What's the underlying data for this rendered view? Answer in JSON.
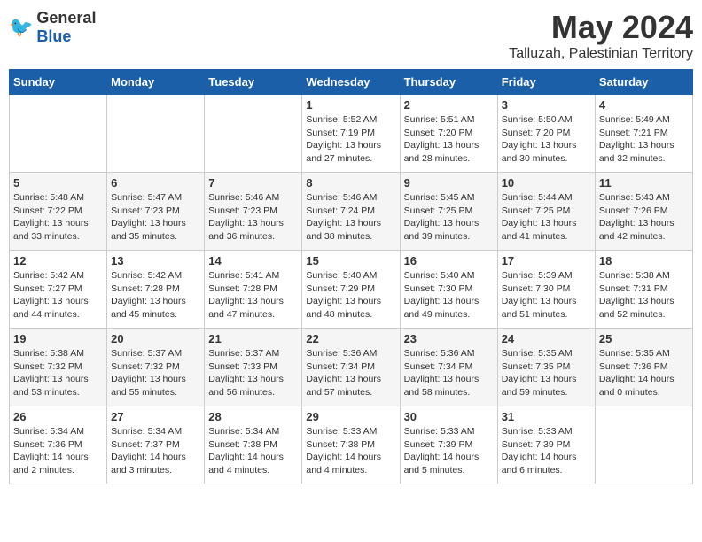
{
  "header": {
    "logo_general": "General",
    "logo_blue": "Blue",
    "month_title": "May 2024",
    "location": "Talluzah, Palestinian Territory"
  },
  "days_of_week": [
    "Sunday",
    "Monday",
    "Tuesday",
    "Wednesday",
    "Thursday",
    "Friday",
    "Saturday"
  ],
  "weeks": [
    {
      "days": [
        {
          "date": "",
          "info": ""
        },
        {
          "date": "",
          "info": ""
        },
        {
          "date": "",
          "info": ""
        },
        {
          "date": "1",
          "info": "Sunrise: 5:52 AM\nSunset: 7:19 PM\nDaylight: 13 hours\nand 27 minutes."
        },
        {
          "date": "2",
          "info": "Sunrise: 5:51 AM\nSunset: 7:20 PM\nDaylight: 13 hours\nand 28 minutes."
        },
        {
          "date": "3",
          "info": "Sunrise: 5:50 AM\nSunset: 7:20 PM\nDaylight: 13 hours\nand 30 minutes."
        },
        {
          "date": "4",
          "info": "Sunrise: 5:49 AM\nSunset: 7:21 PM\nDaylight: 13 hours\nand 32 minutes."
        }
      ]
    },
    {
      "days": [
        {
          "date": "5",
          "info": "Sunrise: 5:48 AM\nSunset: 7:22 PM\nDaylight: 13 hours\nand 33 minutes."
        },
        {
          "date": "6",
          "info": "Sunrise: 5:47 AM\nSunset: 7:23 PM\nDaylight: 13 hours\nand 35 minutes."
        },
        {
          "date": "7",
          "info": "Sunrise: 5:46 AM\nSunset: 7:23 PM\nDaylight: 13 hours\nand 36 minutes."
        },
        {
          "date": "8",
          "info": "Sunrise: 5:46 AM\nSunset: 7:24 PM\nDaylight: 13 hours\nand 38 minutes."
        },
        {
          "date": "9",
          "info": "Sunrise: 5:45 AM\nSunset: 7:25 PM\nDaylight: 13 hours\nand 39 minutes."
        },
        {
          "date": "10",
          "info": "Sunrise: 5:44 AM\nSunset: 7:25 PM\nDaylight: 13 hours\nand 41 minutes."
        },
        {
          "date": "11",
          "info": "Sunrise: 5:43 AM\nSunset: 7:26 PM\nDaylight: 13 hours\nand 42 minutes."
        }
      ]
    },
    {
      "days": [
        {
          "date": "12",
          "info": "Sunrise: 5:42 AM\nSunset: 7:27 PM\nDaylight: 13 hours\nand 44 minutes."
        },
        {
          "date": "13",
          "info": "Sunrise: 5:42 AM\nSunset: 7:28 PM\nDaylight: 13 hours\nand 45 minutes."
        },
        {
          "date": "14",
          "info": "Sunrise: 5:41 AM\nSunset: 7:28 PM\nDaylight: 13 hours\nand 47 minutes."
        },
        {
          "date": "15",
          "info": "Sunrise: 5:40 AM\nSunset: 7:29 PM\nDaylight: 13 hours\nand 48 minutes."
        },
        {
          "date": "16",
          "info": "Sunrise: 5:40 AM\nSunset: 7:30 PM\nDaylight: 13 hours\nand 49 minutes."
        },
        {
          "date": "17",
          "info": "Sunrise: 5:39 AM\nSunset: 7:30 PM\nDaylight: 13 hours\nand 51 minutes."
        },
        {
          "date": "18",
          "info": "Sunrise: 5:38 AM\nSunset: 7:31 PM\nDaylight: 13 hours\nand 52 minutes."
        }
      ]
    },
    {
      "days": [
        {
          "date": "19",
          "info": "Sunrise: 5:38 AM\nSunset: 7:32 PM\nDaylight: 13 hours\nand 53 minutes."
        },
        {
          "date": "20",
          "info": "Sunrise: 5:37 AM\nSunset: 7:32 PM\nDaylight: 13 hours\nand 55 minutes."
        },
        {
          "date": "21",
          "info": "Sunrise: 5:37 AM\nSunset: 7:33 PM\nDaylight: 13 hours\nand 56 minutes."
        },
        {
          "date": "22",
          "info": "Sunrise: 5:36 AM\nSunset: 7:34 PM\nDaylight: 13 hours\nand 57 minutes."
        },
        {
          "date": "23",
          "info": "Sunrise: 5:36 AM\nSunset: 7:34 PM\nDaylight: 13 hours\nand 58 minutes."
        },
        {
          "date": "24",
          "info": "Sunrise: 5:35 AM\nSunset: 7:35 PM\nDaylight: 13 hours\nand 59 minutes."
        },
        {
          "date": "25",
          "info": "Sunrise: 5:35 AM\nSunset: 7:36 PM\nDaylight: 14 hours\nand 0 minutes."
        }
      ]
    },
    {
      "days": [
        {
          "date": "26",
          "info": "Sunrise: 5:34 AM\nSunset: 7:36 PM\nDaylight: 14 hours\nand 2 minutes."
        },
        {
          "date": "27",
          "info": "Sunrise: 5:34 AM\nSunset: 7:37 PM\nDaylight: 14 hours\nand 3 minutes."
        },
        {
          "date": "28",
          "info": "Sunrise: 5:34 AM\nSunset: 7:38 PM\nDaylight: 14 hours\nand 4 minutes."
        },
        {
          "date": "29",
          "info": "Sunrise: 5:33 AM\nSunset: 7:38 PM\nDaylight: 14 hours\nand 4 minutes."
        },
        {
          "date": "30",
          "info": "Sunrise: 5:33 AM\nSunset: 7:39 PM\nDaylight: 14 hours\nand 5 minutes."
        },
        {
          "date": "31",
          "info": "Sunrise: 5:33 AM\nSunset: 7:39 PM\nDaylight: 14 hours\nand 6 minutes."
        },
        {
          "date": "",
          "info": ""
        }
      ]
    }
  ]
}
